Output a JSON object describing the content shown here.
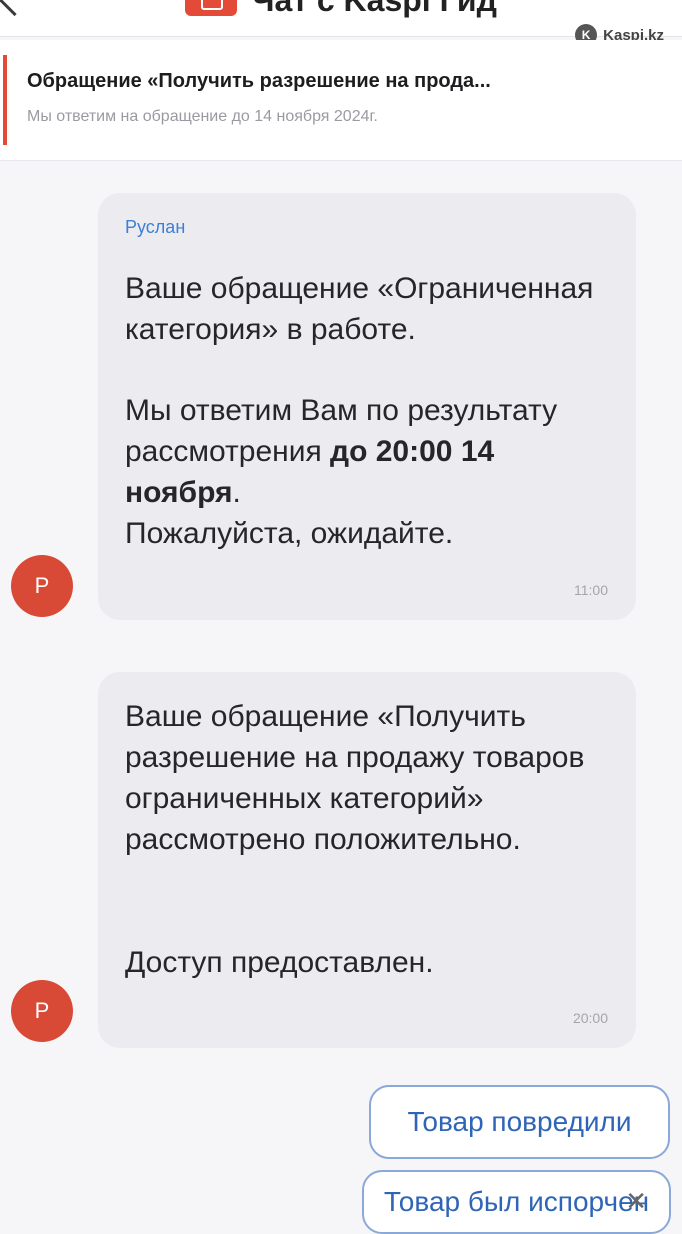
{
  "header": {
    "title": "Чат с Kaspi Гид",
    "watermark": "Kaspi.kz"
  },
  "banner": {
    "title": "Обращение «Получить разрешение на прода...",
    "subtitle": "Мы ответим на обращение до 14 ноября 2024г."
  },
  "messages": [
    {
      "sender": "Руслан",
      "avatar_letter": "Р",
      "p1": "Ваше обращение «Ограниченная категория» в работе.",
      "p2_start": "Мы ответим Вам по результату рассмотрения ",
      "p2_bold": "до 20:00 14 ноября",
      "p2_end": ".",
      "p3": "Пожалуйста, ожидайте.",
      "time": "11:00"
    },
    {
      "avatar_letter": "Р",
      "p1": "Ваше обращение «Получить разрешение на продажу товаров ограниченных категорий» рассмотрено положительно.",
      "p2": "Доступ предоставлен.",
      "time": "20:00"
    }
  ],
  "quick_replies": [
    {
      "label": "Товар повредили"
    },
    {
      "label": "Товар был испорчен"
    }
  ],
  "colors": {
    "accent": "#e34b38",
    "link": "#2f65b6",
    "bubble": "#ececf0"
  }
}
